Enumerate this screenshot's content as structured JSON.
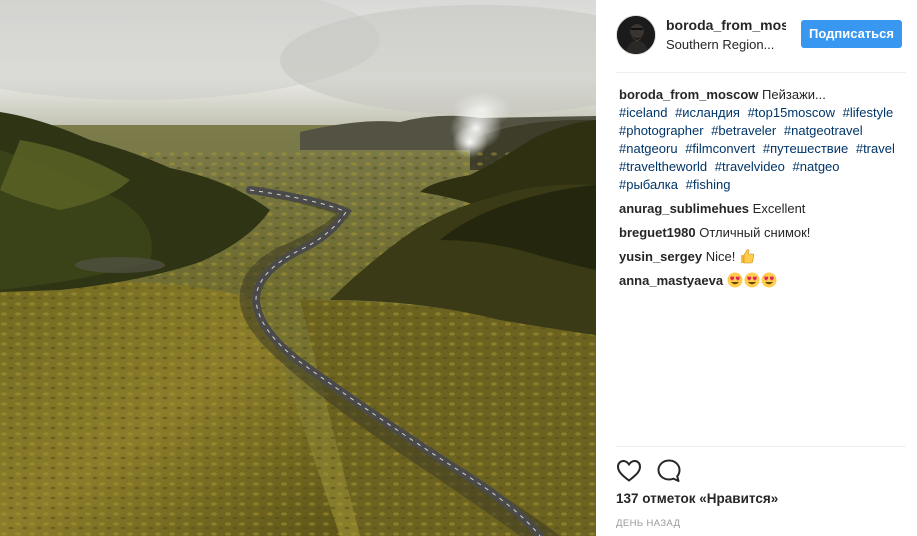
{
  "post": {
    "photo_alt": "",
    "author": {
      "username": "boroda_from_mos",
      "location": "Southern Region..."
    },
    "follow_label": "Подписаться",
    "caption": {
      "username": "boroda_from_moscow",
      "text": "Пейзажи...",
      "hashtags": [
        "#iceland",
        "#исландия",
        "#top15moscow",
        "#lifestyle",
        "#photographer",
        "#betraveler",
        "#natgeotravel",
        "#natgeoru",
        "#filmconvert",
        "#путешествие",
        "#travel",
        "#traveltheworld",
        "#travelvideo",
        "#natgeo",
        "#рыбалка",
        "#fishing"
      ]
    },
    "comments": [
      {
        "username": "anurag_sublimehues",
        "text": "Excellent"
      },
      {
        "username": "breguet1980",
        "text": "Отличный снимок!"
      },
      {
        "username": "yusin_sergey",
        "text": "Nice!",
        "emoji": [
          "thumbs-up"
        ]
      },
      {
        "username": "anna_mastyaeva",
        "text": "",
        "emoji": [
          "heart-eyes",
          "heart-eyes",
          "heart-eyes"
        ]
      }
    ],
    "actions": {
      "like_icon": "heart-outline-icon",
      "comment_icon": "speech-bubble-icon"
    },
    "likes_text": "137 отметок «Нравится»",
    "timestamp": "день назад",
    "colors": {
      "accent": "#3897f0",
      "hashtag": "#003569",
      "muted": "#999999",
      "text": "#262626"
    }
  }
}
